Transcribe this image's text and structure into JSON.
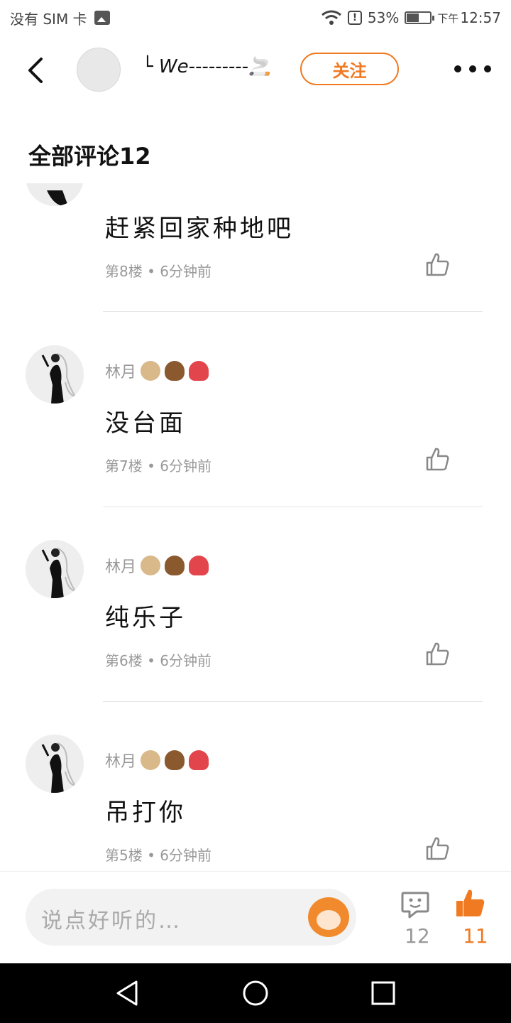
{
  "status_bar": {
    "carrier": "没有 SIM 卡",
    "battery": "53%",
    "battery_level": 0.53,
    "time_prefix": "下午",
    "time": "12:57"
  },
  "header": {
    "username": "└ We---------🚬",
    "follow_label": "关注"
  },
  "section_title": "全部评论12",
  "comments": [
    {
      "text": "赶紧回家种地吧",
      "meta": "第8楼 • 6分钟前"
    },
    {
      "name": "林月",
      "text": "没台面",
      "meta": "第7楼 • 6分钟前"
    },
    {
      "name": "林月",
      "text": "纯乐子",
      "meta": "第6楼 • 6分钟前"
    },
    {
      "name": "林月",
      "text": "吊打你",
      "meta": "第5楼 • 6分钟前"
    }
  ],
  "bottom_bar": {
    "input_placeholder": "说点好听的…",
    "comment_count": "12",
    "like_count": "11"
  },
  "colors": {
    "accent": "#f07a22",
    "text_secondary": "#999999"
  }
}
